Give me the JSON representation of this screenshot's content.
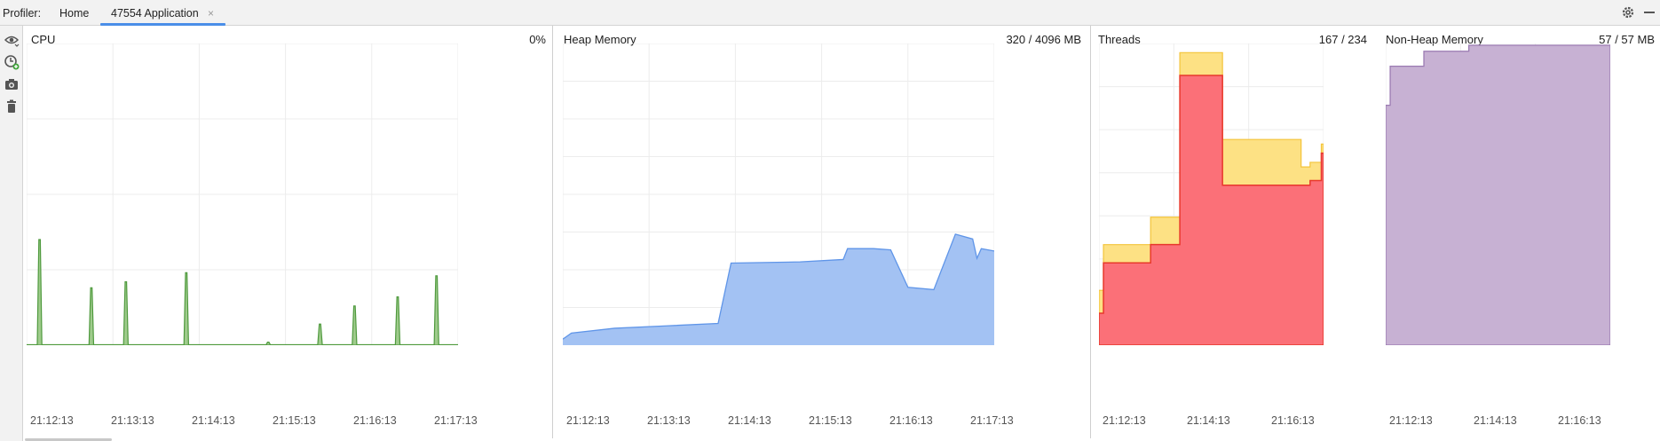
{
  "header": {
    "profiler_label": "Profiler:",
    "tabs": [
      {
        "label": "Home",
        "active": false
      },
      {
        "label": "47554 Application",
        "active": true,
        "close": "×"
      }
    ]
  },
  "toolbar_icons": [
    "eye-icon",
    "add-clock-icon",
    "camera-icon",
    "trash-icon"
  ],
  "colors": {
    "cpu": "#4f9a3e",
    "cpu_fill": "#9fcb8c",
    "heap": "#5f95e8",
    "heap_fill": "#a3c2f3",
    "threads_total": "#f3c43a",
    "threads_total_fill": "#fde184",
    "threads_live": "#e8382c",
    "threads_live_fill": "#fb7078",
    "nonheap": "#9b7bb2",
    "nonheap_fill": "#c7b1d3"
  },
  "panels": {
    "cpu": {
      "title": "CPU",
      "value": "0%"
    },
    "heap": {
      "title": "Heap Memory",
      "value": "320 / 4096 MB"
    },
    "threads": {
      "title": "Threads",
      "value": "167 / 234"
    },
    "nonheap": {
      "title": "Non-Heap Memory",
      "value": "57 / 57 MB"
    }
  },
  "chart_data": [
    {
      "type": "area",
      "title": "CPU",
      "x_ticks": [
        "21:12:13",
        "21:13:13",
        "21:14:13",
        "21:15:13",
        "21:16:13",
        "21:17:13"
      ],
      "ylim": [
        0,
        100
      ],
      "spikes_time_fraction": [
        0.03,
        0.15,
        0.23,
        0.37,
        0.56,
        0.68,
        0.76,
        0.86,
        0.95
      ],
      "spikes_value": [
        35,
        19,
        21,
        24,
        1,
        7,
        13,
        16,
        23
      ]
    },
    {
      "type": "area",
      "title": "Heap Memory",
      "x_ticks": [
        "21:12:13",
        "21:13:13",
        "21:14:13",
        "21:15:13",
        "21:16:13",
        "21:17:13"
      ],
      "ylim": [
        0,
        1000
      ],
      "time_fraction": [
        0,
        0.02,
        0.12,
        0.24,
        0.36,
        0.39,
        0.55,
        0.65,
        0.66,
        0.72,
        0.76,
        0.8,
        0.86,
        0.91,
        0.95,
        0.96,
        0.97,
        1
      ],
      "values": [
        5,
        10,
        14,
        16,
        18,
        68,
        69,
        71,
        80,
        80,
        79,
        48,
        46,
        92,
        88,
        72,
        80,
        78
      ]
    },
    {
      "type": "area",
      "title": "Threads",
      "x_ticks": [
        "21:12:13",
        "21:14:13",
        "21:16:13"
      ],
      "series": [
        {
          "name": "",
          "time_fraction": [
            0,
            0.02,
            0.23,
            0.36,
            0.55,
            0.9,
            0.94,
            0.99,
            1.0
          ],
          "values": [
            60,
            110,
            140,
            320,
            225,
            195,
            200,
            220,
            220
          ]
        },
        {
          "name": "",
          "time_fraction": [
            0,
            0.02,
            0.23,
            0.36,
            0.55,
            0.9,
            0.94,
            0.99,
            1.0
          ],
          "values": [
            35,
            90,
            110,
            295,
            175,
            175,
            180,
            210,
            210
          ]
        }
      ],
      "ylim": [
        0,
        330
      ]
    },
    {
      "type": "area",
      "title": "Non-Heap Memory",
      "x_ticks": [
        "21:12:13",
        "21:14:13",
        "21:16:13"
      ],
      "time_fraction": [
        0,
        0.02,
        0.17,
        0.37,
        1.0
      ],
      "values": [
        80,
        93,
        98,
        100,
        100
      ],
      "ylim": [
        0,
        100
      ]
    }
  ]
}
